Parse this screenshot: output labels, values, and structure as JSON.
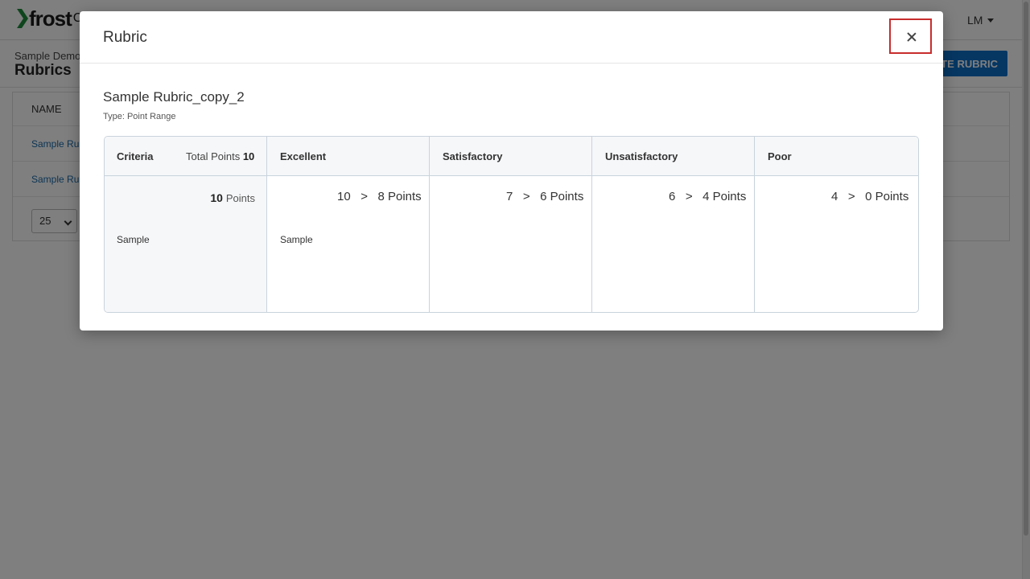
{
  "app": {
    "logo_text": "frost",
    "logo_suffix": "C",
    "user_initials": "LM"
  },
  "subheader": {
    "breadcrumb": "Sample Demo",
    "title": "Rubrics",
    "create_button": "ATE RUBRIC"
  },
  "list": {
    "column_name": "NAME",
    "rows": [
      {
        "name": "Sample Rub"
      },
      {
        "name": "Sample Rub"
      }
    ],
    "page_size": "25"
  },
  "modal": {
    "title": "Rubric",
    "close_label": "×",
    "rubric_name": "Sample Rubric_copy_2",
    "rubric_type": "Type: Point Range",
    "table": {
      "criteria_header": "Criteria",
      "total_points_label": "Total Points",
      "total_points_value": "10",
      "levels": [
        {
          "name": "Excellent",
          "max": "10",
          "min": "8",
          "unit": "Points",
          "description": "Sample"
        },
        {
          "name": "Satisfactory",
          "max": "7",
          "min": "6",
          "unit": "Points",
          "description": ""
        },
        {
          "name": "Unsatisfactory",
          "max": "6",
          "min": "4",
          "unit": "Points",
          "description": ""
        },
        {
          "name": "Poor",
          "max": "4",
          "min": "0",
          "unit": "Points",
          "description": ""
        }
      ],
      "criterion": {
        "points": "10",
        "points_unit": "Points",
        "text": "Sample"
      }
    }
  },
  "colors": {
    "accent_blue": "#0d6ec7",
    "close_highlight": "#c82d2d"
  }
}
